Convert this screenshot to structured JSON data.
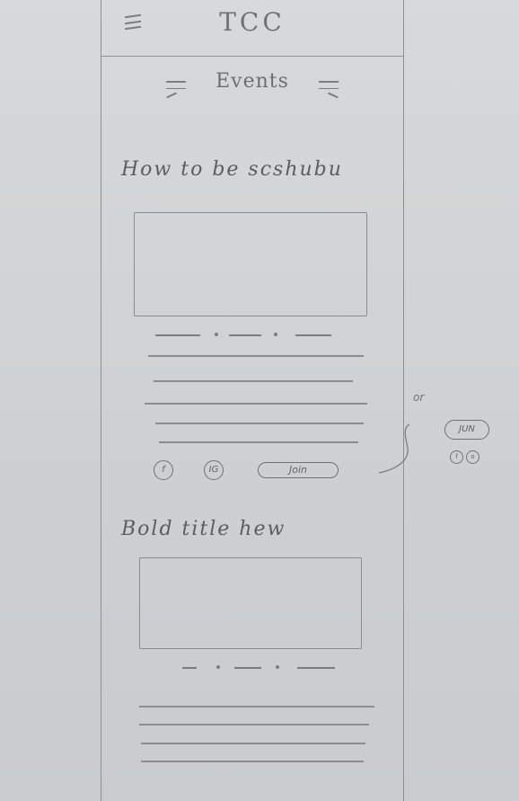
{
  "header": {
    "app_title": "TCC",
    "menu_icon": "hamburger-menu-icon"
  },
  "section": {
    "title": "Events"
  },
  "events": [
    {
      "title": "How to be scshubu",
      "share_icons": [
        "facebook-icon",
        "instagram-icon"
      ],
      "share_labels": [
        "f",
        "IG"
      ],
      "join_label": "Join"
    },
    {
      "title": "Bold title hew"
    }
  ],
  "margin_note": {
    "or_text": "or",
    "alt_button_label": "JUN",
    "alt_icons": [
      "facebook-icon",
      "instagram-icon"
    ]
  }
}
